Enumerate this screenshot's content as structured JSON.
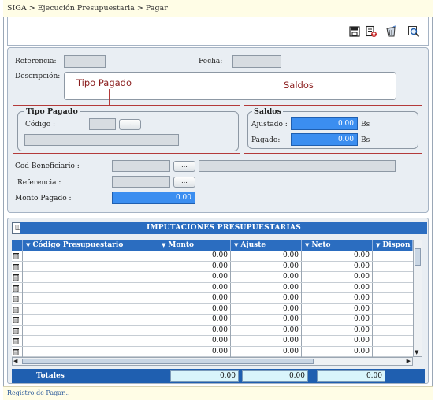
{
  "breadcrumb": "SIGA > Ejecución Presupuestaria > Pagar",
  "toolbar": {
    "icons": [
      "save-icon",
      "delete-icon",
      "trash-icon",
      "search-icon"
    ]
  },
  "form": {
    "referencia_label": "Referencia:",
    "referencia_value": "",
    "fecha_label": "Fecha:",
    "fecha_value": "",
    "descripcion_label": "Descripción:",
    "descripcion_value": "",
    "callout_tipo_pagado": "Tipo Pagado",
    "callout_saldos": "Saldos",
    "tipo_pagado": {
      "title": "Tipo Pagado",
      "codigo_label": "Código :",
      "codigo_value": "",
      "button_label": "...",
      "descripcion_value": ""
    },
    "saldos": {
      "title": "Saldos",
      "ajustado_label": "Ajustado :",
      "ajustado_value": "0.00",
      "ajustado_unit": "Bs",
      "pagado_label": "Pagado:",
      "pagado_value": "0.00",
      "pagado_unit": "Bs"
    },
    "cod_beneficiario_label": "Cod Beneficiario :",
    "cod_beneficiario_value": "",
    "cod_beneficiario_button": "...",
    "beneficiario_nombre": "",
    "referencia2_label": "Referencia :",
    "referencia2_value": "",
    "referencia2_button": "...",
    "monto_pagado_label": "Monto Pagado :",
    "monto_pagado_value": "0.00"
  },
  "grid": {
    "title": "IMPUTACIONES PRESUPUESTARIAS",
    "columns": [
      "Código Presupuestario",
      "Monto",
      "Ajuste",
      "Neto",
      "Dispon"
    ],
    "rows": [
      {
        "codigo": "",
        "monto": "0.00",
        "ajuste": "0.00",
        "neto": "0.00"
      },
      {
        "codigo": "",
        "monto": "0.00",
        "ajuste": "0.00",
        "neto": "0.00"
      },
      {
        "codigo": "",
        "monto": "0.00",
        "ajuste": "0.00",
        "neto": "0.00"
      },
      {
        "codigo": "",
        "monto": "0.00",
        "ajuste": "0.00",
        "neto": "0.00"
      },
      {
        "codigo": "",
        "monto": "0.00",
        "ajuste": "0.00",
        "neto": "0.00"
      },
      {
        "codigo": "",
        "monto": "0.00",
        "ajuste": "0.00",
        "neto": "0.00"
      },
      {
        "codigo": "",
        "monto": "0.00",
        "ajuste": "0.00",
        "neto": "0.00"
      },
      {
        "codigo": "",
        "monto": "0.00",
        "ajuste": "0.00",
        "neto": "0.00"
      },
      {
        "codigo": "",
        "monto": "0.00",
        "ajuste": "0.00",
        "neto": "0.00"
      },
      {
        "codigo": "",
        "monto": "0.00",
        "ajuste": "0.00",
        "neto": "0.00"
      }
    ],
    "totals_label": "Totales",
    "totals": [
      "0.00",
      "0.00",
      "0.00"
    ]
  },
  "status": "Registro de Pagar...",
  "colors": {
    "accent": "#2b6dc0",
    "field_blue": "#3b8ef0",
    "callout": "#b33a3a"
  }
}
